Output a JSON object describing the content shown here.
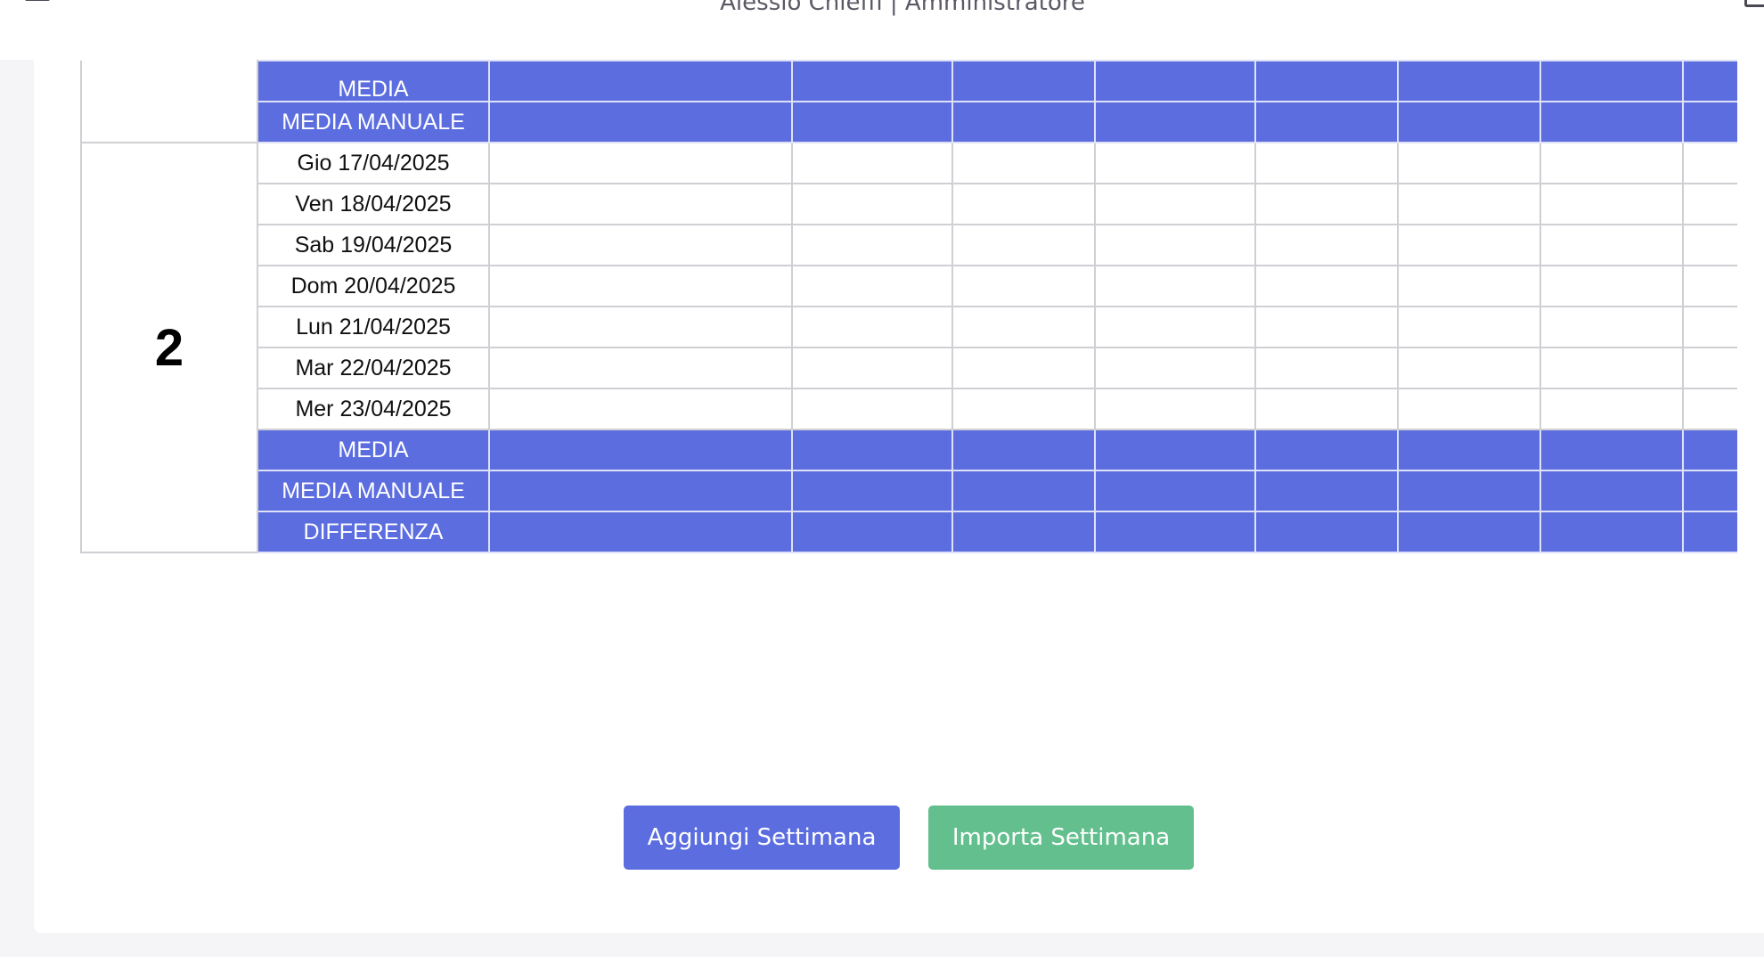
{
  "header": {
    "user_label": "Alessio Chieffi | Amministratore",
    "menu_icon": "hamburger-menu-icon",
    "logout_icon": "logout-icon"
  },
  "table": {
    "top_rows": [
      {
        "label": "MEDIA"
      },
      {
        "label": "MEDIA MANUALE"
      }
    ],
    "week": {
      "number": "2",
      "days": [
        {
          "label": "Gio 17/04/2025"
        },
        {
          "label": "Ven 18/04/2025"
        },
        {
          "label": "Sab 19/04/2025"
        },
        {
          "label": "Dom 20/04/2025"
        },
        {
          "label": "Lun 21/04/2025"
        },
        {
          "label": "Mar 22/04/2025"
        },
        {
          "label": "Mer 23/04/2025"
        }
      ],
      "summary_rows": [
        {
          "label": "MEDIA"
        },
        {
          "label": "MEDIA MANUALE"
        },
        {
          "label": "DIFFERENZA"
        }
      ]
    }
  },
  "actions": {
    "add_week": "Aggiungi Settimana",
    "import_week": "Importa Settimana"
  },
  "colors": {
    "primary": "#5b6ddf",
    "success": "#63c08e",
    "border": "#cfcfd4"
  }
}
